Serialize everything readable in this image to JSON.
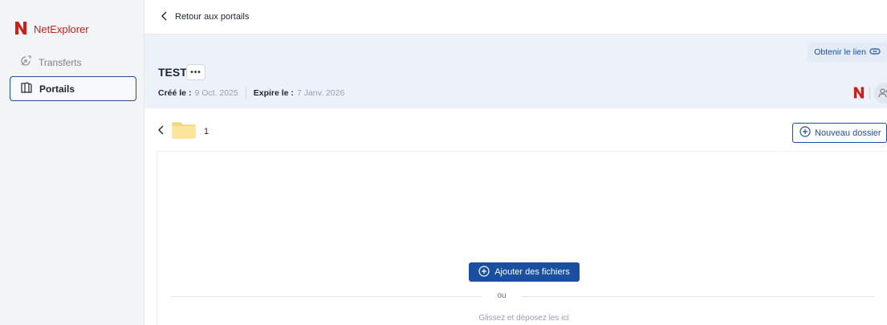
{
  "app": {
    "brand": "NetExplorer"
  },
  "sidebar": {
    "items": [
      {
        "label": "Transferts",
        "icon": "transfer-icon",
        "active": false
      },
      {
        "label": "Portails",
        "icon": "portals-icon",
        "active": true
      }
    ]
  },
  "topbar": {
    "back_label": "Retour aux portails"
  },
  "portal": {
    "title": "TEST",
    "more_label": "•••",
    "created_label": "Créé le :",
    "created_value": "9 Oct. 2025",
    "expires_label": "Expire le :",
    "expires_value": "7 Janv. 2026",
    "get_link_label": "Obtenir le lien"
  },
  "browser": {
    "folder_name": "1",
    "new_folder_label": "Nouveau dossier"
  },
  "dropzone": {
    "add_files_label": "Ajouter des fichiers",
    "or_label": "ou",
    "drop_label": "Glissez et déposez les ici"
  },
  "colors": {
    "brand_red": "#c8201d",
    "primary": "#1a4fa0",
    "header_band": "#edf2fa",
    "folder": "#f7d77a"
  }
}
